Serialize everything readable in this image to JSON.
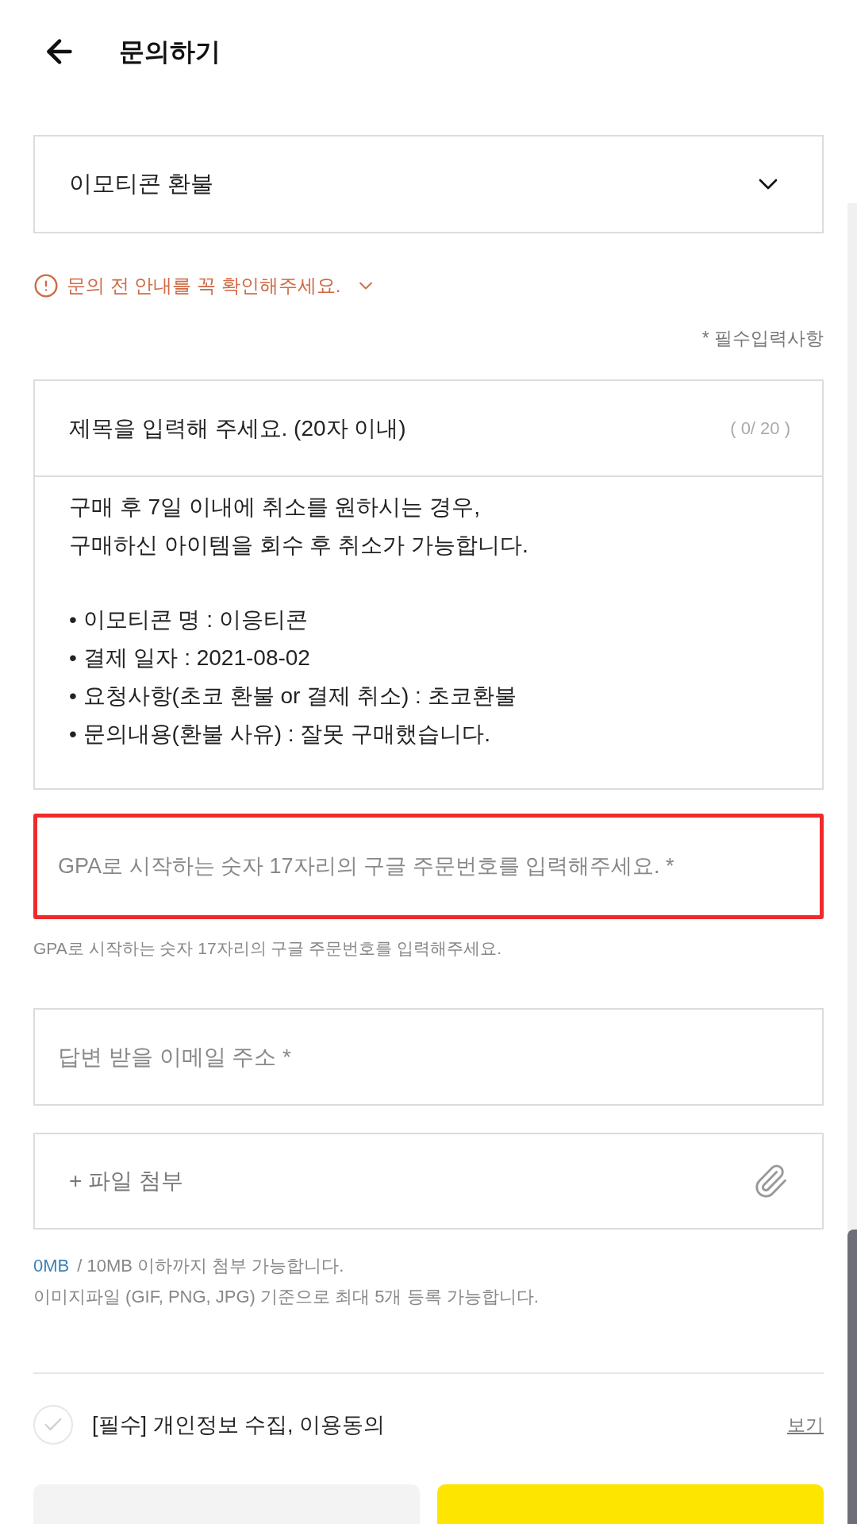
{
  "header": {
    "title": "문의하기"
  },
  "category_select": {
    "value": "이모티콘 환불",
    "expanded": false
  },
  "notice": {
    "text": "문의 전 안내를 꼭 확인해주세요.",
    "expanded": false
  },
  "required_note": "* 필수입력사항",
  "subject": {
    "placeholder": "제목을 입력해 주세요. (20자 이내)",
    "counter": "( 0/ 20 )"
  },
  "message": {
    "lines": [
      "구매 후 7일 이내에 취소를 원하시는 경우,",
      "구매하신 아이템을 회수 후 취소가 가능합니다."
    ],
    "bullets": [
      "• 이모티콘 명 : 이응티콘",
      "• 결제 일자 : 2021-08-02",
      "• 요청사항(초코 환불 or 결제 취소) : 초코환불",
      "• 문의내용(환불 사유) : 잘못 구매했습니다."
    ]
  },
  "order_number": {
    "placeholder": "GPA로 시작하는 숫자 17자리의 구글 주문번호를 입력해주세요. *",
    "highlighted": true,
    "helper": "GPA로 시작하는 숫자 17자리의 구글 주문번호를 입력해주세요."
  },
  "email": {
    "placeholder": "답변 받을 이메일 주소 *"
  },
  "attachment": {
    "label": "+ 파일 첨부",
    "used": "0MB",
    "limit": "/ 10MB 이하까지 첨부 가능합니다.",
    "rule": "이미지파일 (GIF, PNG, JPG) 기준으로 최대 5개 등록 가능합니다."
  },
  "consent": {
    "label": "[필수] 개인정보 수집, 이용동의",
    "checked": false,
    "link": "보기"
  },
  "buttons": [
    {
      "kind": "secondary"
    },
    {
      "kind": "primary"
    }
  ]
}
